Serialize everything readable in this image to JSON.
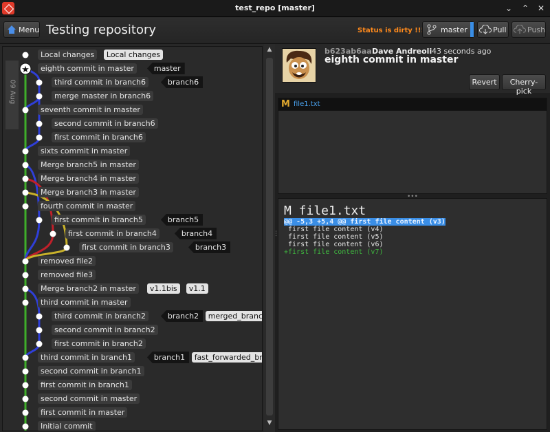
{
  "window": {
    "title": "test_repo [master]"
  },
  "toolbar": {
    "menu_label": "Menu",
    "repo_title": "Testing repository",
    "status": "Status is dirty !!!",
    "branch": "master",
    "pull_label": "Pull",
    "push_label": "Push"
  },
  "date_label": "09 Aug",
  "commits": [
    {
      "msg": "Local changes",
      "tags": [
        {
          "text": "Local changes",
          "style": "light"
        }
      ]
    },
    {
      "msg": "eighth commit in master",
      "tags": [
        {
          "text": "master",
          "style": "dark"
        }
      ]
    },
    {
      "msg": "third commit in branch6",
      "tags": [
        {
          "text": "branch6",
          "style": "dark"
        }
      ]
    },
    {
      "msg": "merge master in branch6",
      "tags": []
    },
    {
      "msg": "seventh commit in master",
      "tags": []
    },
    {
      "msg": "second commit in branch6",
      "tags": []
    },
    {
      "msg": "first commit in branch6",
      "tags": []
    },
    {
      "msg": "sixts commit in master",
      "tags": []
    },
    {
      "msg": "Merge branch5 in master",
      "tags": []
    },
    {
      "msg": "Merge branch4 in master",
      "tags": []
    },
    {
      "msg": "Merge branch3 in master",
      "tags": []
    },
    {
      "msg": "fourth commit in master",
      "tags": []
    },
    {
      "msg": "first commit in branch5",
      "tags": [
        {
          "text": "branch5",
          "style": "dark"
        }
      ]
    },
    {
      "msg": "first commit in branch4",
      "tags": [
        {
          "text": "branch4",
          "style": "dark"
        }
      ]
    },
    {
      "msg": "first commit in branch3",
      "tags": [
        {
          "text": "branch3",
          "style": "dark"
        }
      ]
    },
    {
      "msg": "removed file2",
      "tags": []
    },
    {
      "msg": "removed file3",
      "tags": []
    },
    {
      "msg": "Merge branch2 in master",
      "tags": [
        {
          "text": "v1.1bis",
          "style": "light"
        },
        {
          "text": "v1.1",
          "style": "light"
        }
      ]
    },
    {
      "msg": "third commit in master",
      "tags": []
    },
    {
      "msg": "third commit in branch2",
      "tags": [
        {
          "text": "branch2",
          "style": "dark"
        },
        {
          "text": "merged_branch",
          "style": "light"
        }
      ]
    },
    {
      "msg": "second commit in branch2",
      "tags": []
    },
    {
      "msg": "first commit in branch2",
      "tags": []
    },
    {
      "msg": "third commit in branch1",
      "tags": [
        {
          "text": "branch1",
          "style": "dark"
        },
        {
          "text": "fast_forwarded_branch",
          "style": "light"
        }
      ]
    },
    {
      "msg": "second commit in branch1",
      "tags": []
    },
    {
      "msg": "first commit in branch1",
      "tags": []
    },
    {
      "msg": "second commit in master",
      "tags": []
    },
    {
      "msg": "first commit in master",
      "tags": []
    },
    {
      "msg": "Initial commit",
      "tags": []
    }
  ],
  "detail": {
    "hash": "b623ab6aa",
    "author": "Dave Andreoli",
    "time": "43 seconds ago",
    "subject": "eighth commit in master",
    "revert_label": "Revert",
    "cherry_label": "Cherry-pick"
  },
  "files": [
    {
      "status": "M",
      "name": "file1.txt"
    }
  ],
  "diff": {
    "file": "M file1.txt",
    "lines": [
      {
        "text": "@@ -5,3 +5,4 @@ first file content (v3)",
        "kind": "hunk"
      },
      {
        "text": " first file content (v4)",
        "kind": "ctx"
      },
      {
        "text": " first file content (v5)",
        "kind": "ctx"
      },
      {
        "text": " first file content (v6)",
        "kind": "ctx"
      },
      {
        "text": "+first file content (v7)",
        "kind": "add"
      }
    ]
  },
  "colors": {
    "accent": "#3a8ee6",
    "status": "#ff8a1c",
    "graph_green": "#3fae2a",
    "graph_blue": "#2f3fd8",
    "graph_red": "#c0202a",
    "graph_yellow": "#c9b22a",
    "diff_add": "#3fb83f",
    "diff_hunk": "#3a8ee6"
  }
}
